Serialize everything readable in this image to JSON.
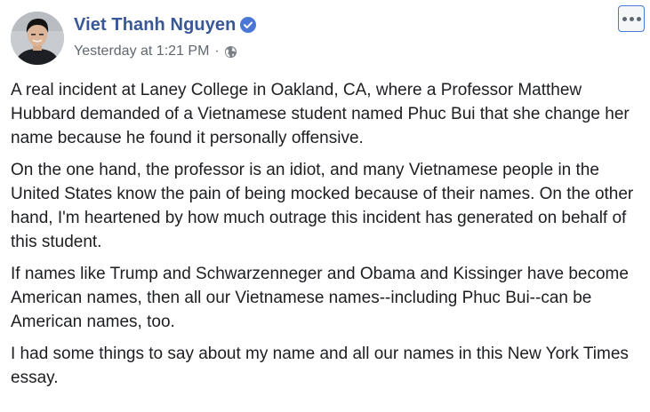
{
  "post": {
    "author_name": "Viet Thanh Nguyen",
    "timestamp": "Yesterday at 1:21 PM",
    "separator": "·",
    "icons": {
      "verified": "verified-badge-icon",
      "privacy": "globe-icon",
      "more": "more-options-icon"
    },
    "colors": {
      "author_link": "#385898",
      "verified_badge": "#4a76d6",
      "meta_text": "#616770",
      "body_text": "#1c1e21"
    },
    "paragraphs": [
      "A real incident at Laney College in Oakland, CA, where a Professor Matthew Hubbard demanded of a Vietnamese student named Phuc Bui that she change her name because he found it personally offensive.",
      "On the one hand, the professor is an idiot, and many Vietnamese people in the United States know the pain of being mocked because of their names. On the other hand, I'm heartened by how much outrage this incident has generated on behalf of this student.",
      "If names like Trump and Schwarzenneger and Obama and Kissinger have become American names, then all our Vietnamese names--including Phuc Bui--can be American names, too.",
      "I had some things to say about my name and all our names in this New York Times essay."
    ]
  }
}
